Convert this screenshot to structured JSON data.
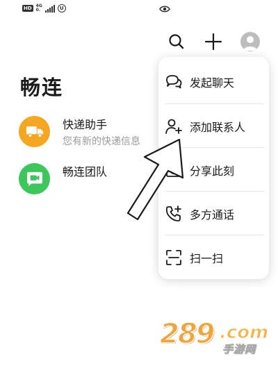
{
  "status_bar": {
    "hd_label": "HD",
    "network_label": "4G",
    "network_sub": "0.",
    "circle_label": "U"
  },
  "header": {
    "search_icon": "search-icon",
    "add_icon": "plus-icon",
    "avatar_icon": "avatar-icon"
  },
  "page": {
    "title": "畅连"
  },
  "chats": [
    {
      "name": "快递助手",
      "preview": "您有新的快递信息",
      "icon": "truck-icon",
      "color": "#f5a623"
    },
    {
      "name": "畅连团队",
      "preview": "",
      "icon": "video-chat-icon",
      "color": "#3cc65c"
    }
  ],
  "popup_menu": {
    "items": [
      {
        "label": "发起聊天",
        "icon": "chat-bubbles-icon"
      },
      {
        "label": "添加联系人",
        "icon": "add-contact-icon"
      },
      {
        "label": "分享此刻",
        "icon": "camera-icon"
      },
      {
        "label": "多方通话",
        "icon": "group-call-icon"
      },
      {
        "label": "扫一扫",
        "icon": "scan-icon"
      }
    ]
  },
  "watermark": {
    "number": "289",
    "domain": ".com",
    "site_name": "手游网"
  }
}
